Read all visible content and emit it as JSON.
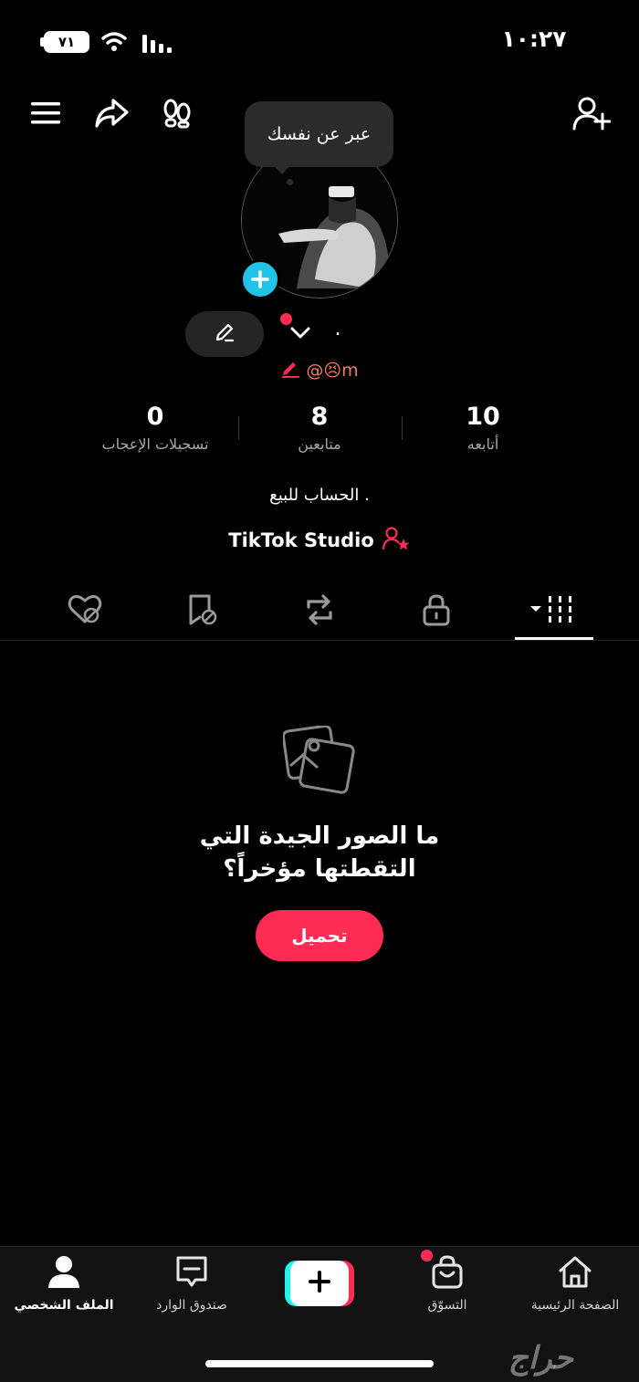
{
  "status_bar": {
    "time": "١٠:٢٧",
    "battery": "٧١"
  },
  "tooltip": {
    "text": "عبر عن نفسك"
  },
  "profile": {
    "name": ".",
    "username": "@😣m"
  },
  "stats": [
    {
      "value": "10",
      "label": "أتابعه"
    },
    {
      "value": "8",
      "label": "متابعين"
    },
    {
      "value": "0",
      "label": "تسجيلات الإعجاب"
    }
  ],
  "bio": "الحساب للبيع .",
  "studio": {
    "label": "TikTok Studio"
  },
  "empty_state": {
    "line1": "ما الصور الجيدة التي",
    "line2": "التقطتها مؤخراً؟",
    "button": "تحميل"
  },
  "bottom_nav": {
    "home": "الصفحة الرئيسية",
    "shop": "التسوّق",
    "inbox": "صندوق الوارد",
    "profile": "الملف الشخصي"
  },
  "watermark": "حراج",
  "colors": {
    "accent": "#fe2c55",
    "cyan": "#20c4e6",
    "username": "#f37b5a"
  }
}
